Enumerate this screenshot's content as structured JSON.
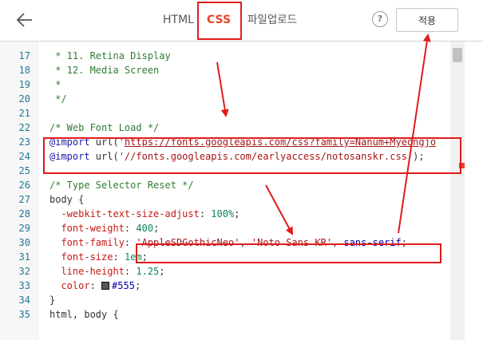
{
  "header": {
    "tabs": [
      {
        "label": "HTML",
        "active": false
      },
      {
        "label": "CSS",
        "active": true
      },
      {
        "label": "파일업로드",
        "active": false
      }
    ],
    "help_label": "?",
    "apply_label": "적용"
  },
  "editor": {
    "lines": [
      {
        "n": "17",
        "tokens": [
          {
            "t": " * 11. Retina Display",
            "c": "comment"
          }
        ]
      },
      {
        "n": "18",
        "tokens": [
          {
            "t": " * 12. Media Screen",
            "c": "comment"
          }
        ]
      },
      {
        "n": "19",
        "tokens": [
          {
            "t": " *",
            "c": "comment"
          }
        ]
      },
      {
        "n": "20",
        "tokens": [
          {
            "t": " */",
            "c": "comment"
          }
        ]
      },
      {
        "n": "21",
        "tokens": []
      },
      {
        "n": "22",
        "tokens": [
          {
            "t": "/* Web Font Load */",
            "c": "comment"
          }
        ]
      },
      {
        "n": "23",
        "tokens": [
          {
            "t": "@import",
            "c": "at"
          },
          {
            "t": " url(",
            "c": "fn"
          },
          {
            "t": "'",
            "c": "str"
          },
          {
            "t": "https://fonts.googleapis.com/css?family=Nanum+Myeongjo",
            "c": "strlink"
          }
        ]
      },
      {
        "n": "24",
        "tokens": [
          {
            "t": "@import",
            "c": "at"
          },
          {
            "t": " url(",
            "c": "fn"
          },
          {
            "t": "'//fonts.googleapis.com/earlyaccess/notosanskr.css'",
            "c": "str"
          },
          {
            "t": ");",
            "c": "fn"
          }
        ]
      },
      {
        "n": "25",
        "tokens": []
      },
      {
        "n": "26",
        "tokens": [
          {
            "t": "/* Type Selector Reset */",
            "c": "comment"
          }
        ]
      },
      {
        "n": "27",
        "tokens": [
          {
            "t": "body {",
            "c": "sel"
          }
        ]
      },
      {
        "n": "28",
        "tokens": [
          {
            "t": "  -webkit-text-size-adjust",
            "c": "prop"
          },
          {
            "t": ": ",
            "c": "fn"
          },
          {
            "t": "100%",
            "c": "num"
          },
          {
            "t": ";",
            "c": "fn"
          }
        ]
      },
      {
        "n": "29",
        "tokens": [
          {
            "t": "  font-weight",
            "c": "prop"
          },
          {
            "t": ": ",
            "c": "fn"
          },
          {
            "t": "400",
            "c": "num"
          },
          {
            "t": ";",
            "c": "fn"
          }
        ]
      },
      {
        "n": "30",
        "tokens": [
          {
            "t": "  font-family",
            "c": "prop"
          },
          {
            "t": ": ",
            "c": "fn"
          },
          {
            "t": "'AppleSDGothicNeo'",
            "c": "str"
          },
          {
            "t": ", ",
            "c": "fn"
          },
          {
            "t": "'Noto Sans KR'",
            "c": "str"
          },
          {
            "t": ", ",
            "c": "fn"
          },
          {
            "t": "sans-serif",
            "c": "kw"
          },
          {
            "t": ";",
            "c": "fn"
          }
        ]
      },
      {
        "n": "31",
        "tokens": [
          {
            "t": "  font-size",
            "c": "prop"
          },
          {
            "t": ": ",
            "c": "fn"
          },
          {
            "t": "1em",
            "c": "num"
          },
          {
            "t": ";",
            "c": "fn"
          }
        ]
      },
      {
        "n": "32",
        "tokens": [
          {
            "t": "  line-height",
            "c": "prop"
          },
          {
            "t": ": ",
            "c": "fn"
          },
          {
            "t": "1.25",
            "c": "num"
          },
          {
            "t": ";",
            "c": "fn"
          }
        ]
      },
      {
        "n": "33",
        "tokens": [
          {
            "t": "  color",
            "c": "prop"
          },
          {
            "t": ": ",
            "c": "fn"
          },
          {
            "t": "",
            "c": "swatch"
          },
          {
            "t": "#555",
            "c": "kw"
          },
          {
            "t": ";",
            "c": "fn"
          }
        ]
      },
      {
        "n": "34",
        "tokens": [
          {
            "t": "}",
            "c": "sel"
          }
        ]
      },
      {
        "n": "35",
        "tokens": [
          {
            "t": "html, body {",
            "c": "sel"
          }
        ]
      }
    ]
  },
  "colors": {
    "annotation_red": "#e01b1b",
    "active_tab": "#e8432a",
    "comment": "#2e7d32",
    "color_swatch": "#555555"
  }
}
